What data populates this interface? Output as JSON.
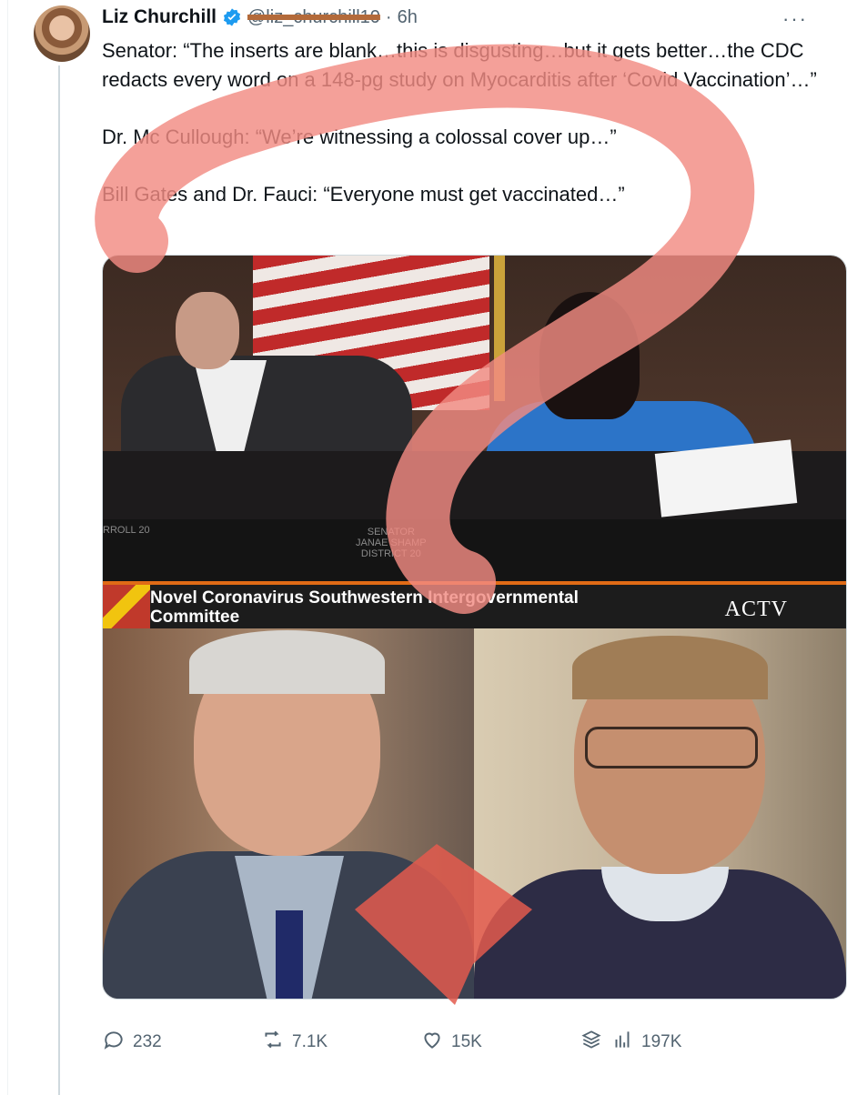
{
  "author": {
    "name": "Liz Churchill",
    "handle": "@liz_churchill10",
    "separator": "·",
    "timestamp": "6h"
  },
  "more_label": "···",
  "tweet": {
    "text": "Senator: “The inserts are blank…this is disgusting…but it gets better…the CDC redacts every word on a 148-pg study on Myocarditis after ‘Covid Vaccination’…”\n\nDr. Mc Cullough: “We’re witnessing a colossal cover up…”\n\nBill Gates and Dr. Fauci: “Everyone must get vaccinated…”"
  },
  "media": {
    "nameplate_left": "RROLL 20",
    "nameplate_center_l1": "SENATOR",
    "nameplate_center_l2": "JANAE SHAMP",
    "nameplate_center_l3": "DISTRICT 20",
    "lower_third_line1": "Novel Coronavirus Southwestern Intergovernmental",
    "lower_third_line2": "Committee",
    "channel_logo": "ACTV"
  },
  "actions": {
    "replies": "232",
    "reposts": "7.1K",
    "likes": "15K",
    "views": "197K"
  },
  "colors": {
    "overlay_mark": "#f28b82",
    "verified_badge": "#1d9bf0",
    "secondary_text": "#536471"
  }
}
